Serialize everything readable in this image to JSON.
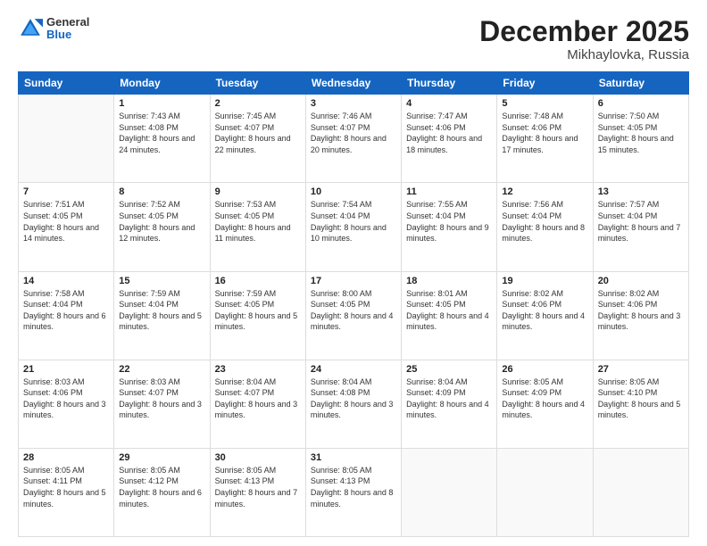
{
  "header": {
    "logo_general": "General",
    "logo_blue": "Blue",
    "month_year": "December 2025",
    "location": "Mikhaylovka, Russia"
  },
  "calendar": {
    "days": [
      "Sunday",
      "Monday",
      "Tuesday",
      "Wednesday",
      "Thursday",
      "Friday",
      "Saturday"
    ],
    "weeks": [
      [
        {
          "date": "",
          "sunrise": "",
          "sunset": "",
          "daylight": ""
        },
        {
          "date": "1",
          "sunrise": "Sunrise: 7:43 AM",
          "sunset": "Sunset: 4:08 PM",
          "daylight": "Daylight: 8 hours and 24 minutes."
        },
        {
          "date": "2",
          "sunrise": "Sunrise: 7:45 AM",
          "sunset": "Sunset: 4:07 PM",
          "daylight": "Daylight: 8 hours and 22 minutes."
        },
        {
          "date": "3",
          "sunrise": "Sunrise: 7:46 AM",
          "sunset": "Sunset: 4:07 PM",
          "daylight": "Daylight: 8 hours and 20 minutes."
        },
        {
          "date": "4",
          "sunrise": "Sunrise: 7:47 AM",
          "sunset": "Sunset: 4:06 PM",
          "daylight": "Daylight: 8 hours and 18 minutes."
        },
        {
          "date": "5",
          "sunrise": "Sunrise: 7:48 AM",
          "sunset": "Sunset: 4:06 PM",
          "daylight": "Daylight: 8 hours and 17 minutes."
        },
        {
          "date": "6",
          "sunrise": "Sunrise: 7:50 AM",
          "sunset": "Sunset: 4:05 PM",
          "daylight": "Daylight: 8 hours and 15 minutes."
        }
      ],
      [
        {
          "date": "7",
          "sunrise": "Sunrise: 7:51 AM",
          "sunset": "Sunset: 4:05 PM",
          "daylight": "Daylight: 8 hours and 14 minutes."
        },
        {
          "date": "8",
          "sunrise": "Sunrise: 7:52 AM",
          "sunset": "Sunset: 4:05 PM",
          "daylight": "Daylight: 8 hours and 12 minutes."
        },
        {
          "date": "9",
          "sunrise": "Sunrise: 7:53 AM",
          "sunset": "Sunset: 4:05 PM",
          "daylight": "Daylight: 8 hours and 11 minutes."
        },
        {
          "date": "10",
          "sunrise": "Sunrise: 7:54 AM",
          "sunset": "Sunset: 4:04 PM",
          "daylight": "Daylight: 8 hours and 10 minutes."
        },
        {
          "date": "11",
          "sunrise": "Sunrise: 7:55 AM",
          "sunset": "Sunset: 4:04 PM",
          "daylight": "Daylight: 8 hours and 9 minutes."
        },
        {
          "date": "12",
          "sunrise": "Sunrise: 7:56 AM",
          "sunset": "Sunset: 4:04 PM",
          "daylight": "Daylight: 8 hours and 8 minutes."
        },
        {
          "date": "13",
          "sunrise": "Sunrise: 7:57 AM",
          "sunset": "Sunset: 4:04 PM",
          "daylight": "Daylight: 8 hours and 7 minutes."
        }
      ],
      [
        {
          "date": "14",
          "sunrise": "Sunrise: 7:58 AM",
          "sunset": "Sunset: 4:04 PM",
          "daylight": "Daylight: 8 hours and 6 minutes."
        },
        {
          "date": "15",
          "sunrise": "Sunrise: 7:59 AM",
          "sunset": "Sunset: 4:04 PM",
          "daylight": "Daylight: 8 hours and 5 minutes."
        },
        {
          "date": "16",
          "sunrise": "Sunrise: 7:59 AM",
          "sunset": "Sunset: 4:05 PM",
          "daylight": "Daylight: 8 hours and 5 minutes."
        },
        {
          "date": "17",
          "sunrise": "Sunrise: 8:00 AM",
          "sunset": "Sunset: 4:05 PM",
          "daylight": "Daylight: 8 hours and 4 minutes."
        },
        {
          "date": "18",
          "sunrise": "Sunrise: 8:01 AM",
          "sunset": "Sunset: 4:05 PM",
          "daylight": "Daylight: 8 hours and 4 minutes."
        },
        {
          "date": "19",
          "sunrise": "Sunrise: 8:02 AM",
          "sunset": "Sunset: 4:06 PM",
          "daylight": "Daylight: 8 hours and 4 minutes."
        },
        {
          "date": "20",
          "sunrise": "Sunrise: 8:02 AM",
          "sunset": "Sunset: 4:06 PM",
          "daylight": "Daylight: 8 hours and 3 minutes."
        }
      ],
      [
        {
          "date": "21",
          "sunrise": "Sunrise: 8:03 AM",
          "sunset": "Sunset: 4:06 PM",
          "daylight": "Daylight: 8 hours and 3 minutes."
        },
        {
          "date": "22",
          "sunrise": "Sunrise: 8:03 AM",
          "sunset": "Sunset: 4:07 PM",
          "daylight": "Daylight: 8 hours and 3 minutes."
        },
        {
          "date": "23",
          "sunrise": "Sunrise: 8:04 AM",
          "sunset": "Sunset: 4:07 PM",
          "daylight": "Daylight: 8 hours and 3 minutes."
        },
        {
          "date": "24",
          "sunrise": "Sunrise: 8:04 AM",
          "sunset": "Sunset: 4:08 PM",
          "daylight": "Daylight: 8 hours and 3 minutes."
        },
        {
          "date": "25",
          "sunrise": "Sunrise: 8:04 AM",
          "sunset": "Sunset: 4:09 PM",
          "daylight": "Daylight: 8 hours and 4 minutes."
        },
        {
          "date": "26",
          "sunrise": "Sunrise: 8:05 AM",
          "sunset": "Sunset: 4:09 PM",
          "daylight": "Daylight: 8 hours and 4 minutes."
        },
        {
          "date": "27",
          "sunrise": "Sunrise: 8:05 AM",
          "sunset": "Sunset: 4:10 PM",
          "daylight": "Daylight: 8 hours and 5 minutes."
        }
      ],
      [
        {
          "date": "28",
          "sunrise": "Sunrise: 8:05 AM",
          "sunset": "Sunset: 4:11 PM",
          "daylight": "Daylight: 8 hours and 5 minutes."
        },
        {
          "date": "29",
          "sunrise": "Sunrise: 8:05 AM",
          "sunset": "Sunset: 4:12 PM",
          "daylight": "Daylight: 8 hours and 6 minutes."
        },
        {
          "date": "30",
          "sunrise": "Sunrise: 8:05 AM",
          "sunset": "Sunset: 4:13 PM",
          "daylight": "Daylight: 8 hours and 7 minutes."
        },
        {
          "date": "31",
          "sunrise": "Sunrise: 8:05 AM",
          "sunset": "Sunset: 4:13 PM",
          "daylight": "Daylight: 8 hours and 8 minutes."
        },
        {
          "date": "",
          "sunrise": "",
          "sunset": "",
          "daylight": ""
        },
        {
          "date": "",
          "sunrise": "",
          "sunset": "",
          "daylight": ""
        },
        {
          "date": "",
          "sunrise": "",
          "sunset": "",
          "daylight": ""
        }
      ]
    ]
  }
}
